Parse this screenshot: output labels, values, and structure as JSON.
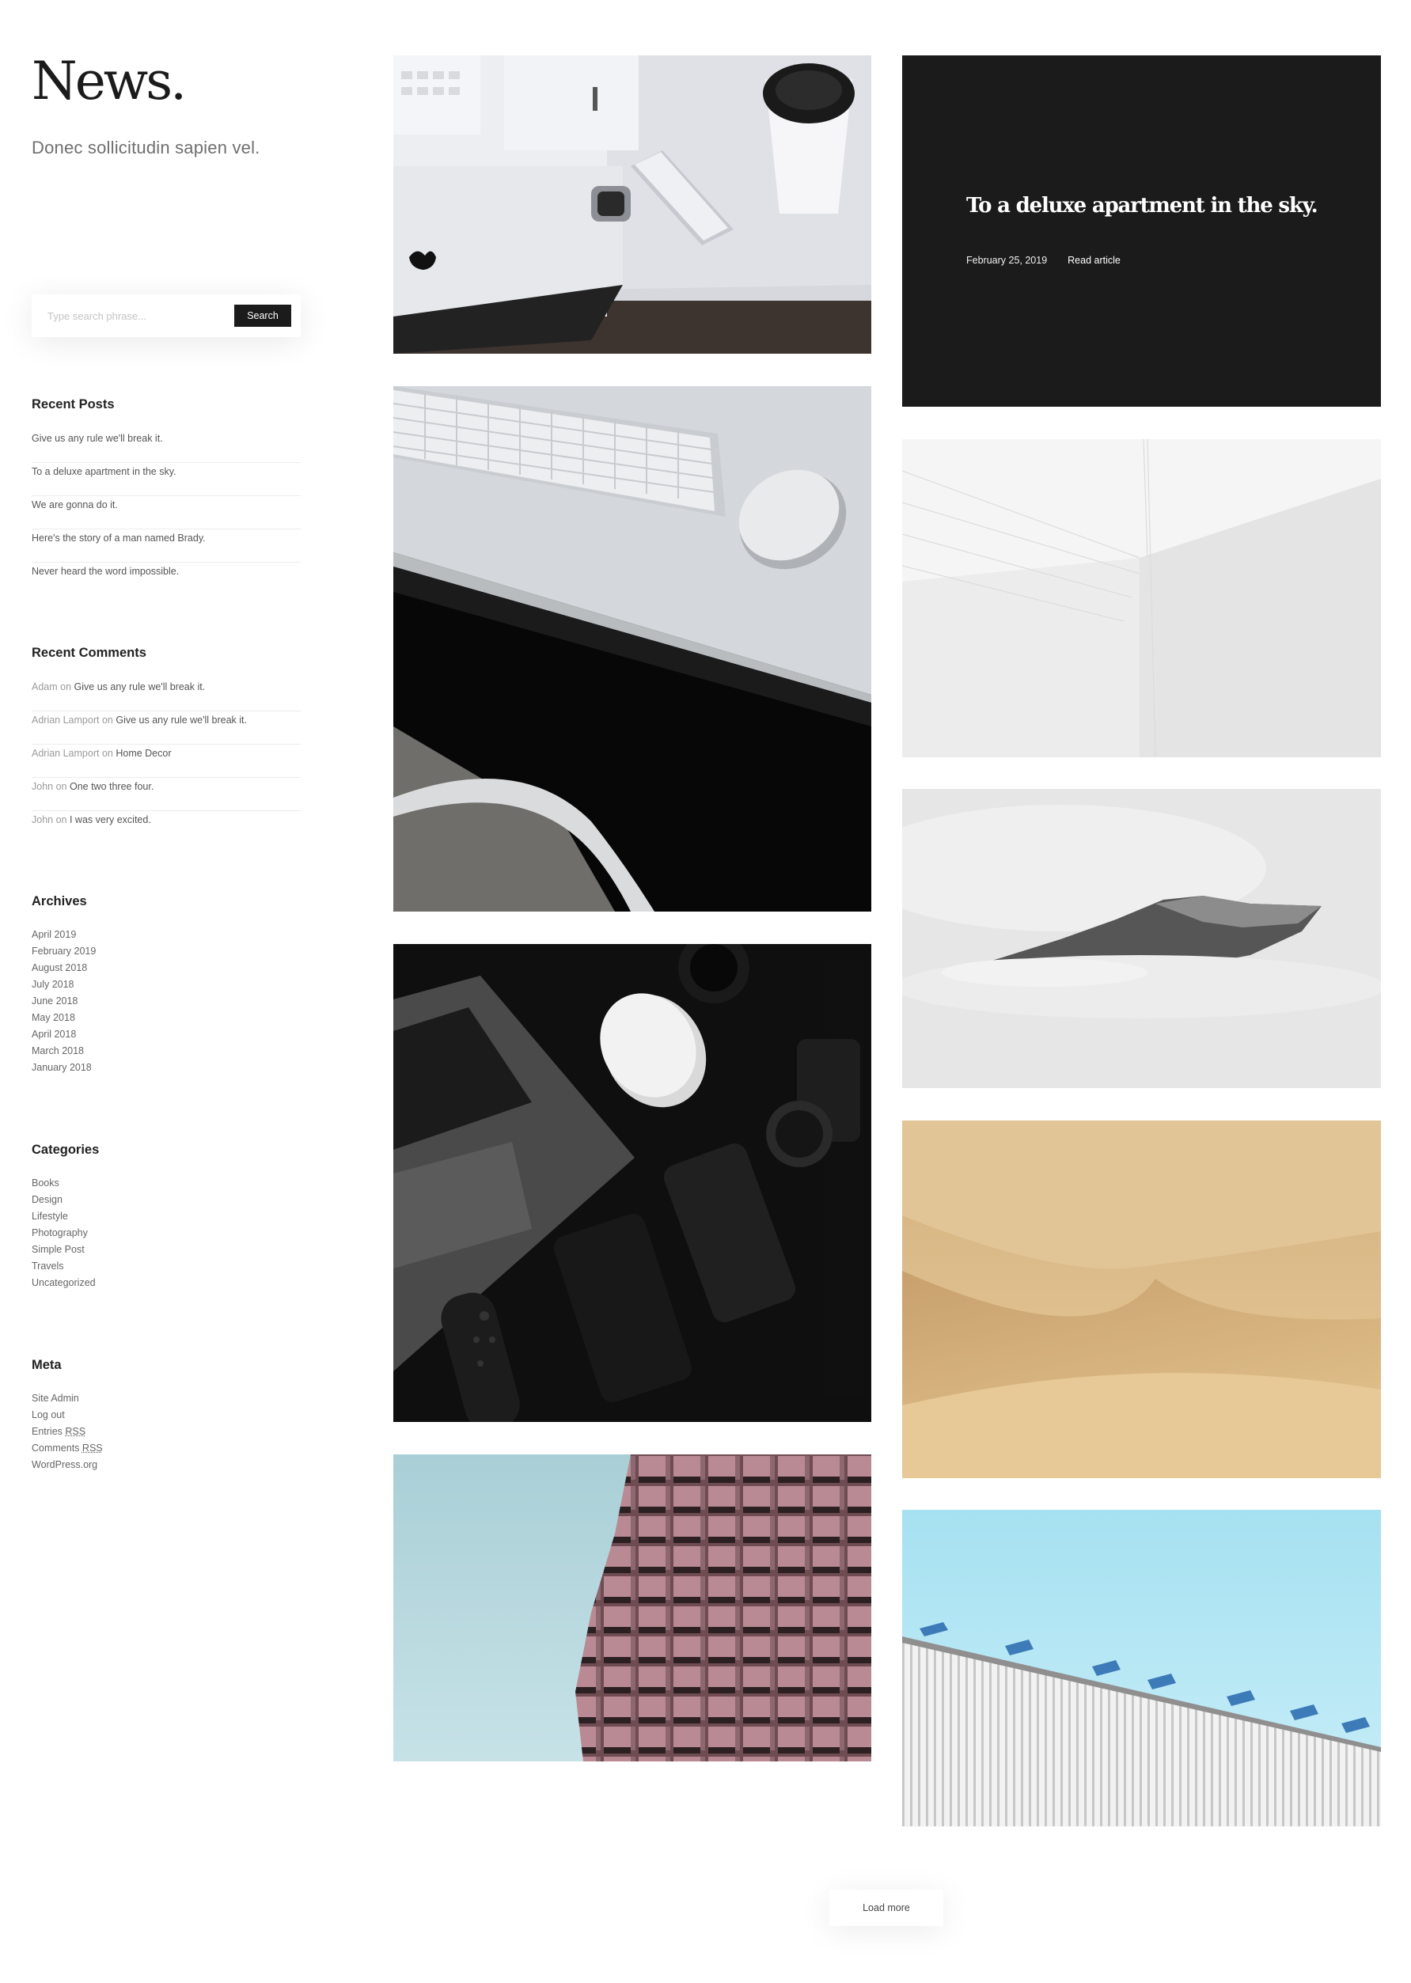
{
  "site": {
    "title": "News.",
    "tagline": "Donec sollicitudin sapien vel."
  },
  "search": {
    "placeholder": "Type search phrase...",
    "button_label": "Search"
  },
  "recent_posts": {
    "title": "Recent Posts",
    "items": [
      "Give us any rule we'll break it.",
      "To a deluxe apartment in the sky.",
      "We are gonna do it.",
      "Here's the story of a man named Brady.",
      "Never heard the word impossible."
    ]
  },
  "recent_comments": {
    "title": "Recent Comments",
    "on_word": "on",
    "items": [
      {
        "author": "Adam",
        "post": "Give us any rule we'll break it."
      },
      {
        "author": "Adrian Lamport",
        "post": "Give us any rule we'll break it."
      },
      {
        "author": "Adrian Lamport",
        "post": "Home Decor"
      },
      {
        "author": "John",
        "post": "One two three four."
      },
      {
        "author": "John",
        "post": "I was very excited."
      }
    ]
  },
  "archives": {
    "title": "Archives",
    "items": [
      "April 2019",
      "February 2019",
      "August 2018",
      "July 2018",
      "June 2018",
      "May 2018",
      "April 2018",
      "March 2018",
      "January 2018"
    ]
  },
  "categories": {
    "title": "Categories",
    "items": [
      "Books",
      "Design",
      "Lifestyle",
      "Photography",
      "Simple Post",
      "Travels",
      "Uncategorized"
    ]
  },
  "meta": {
    "title": "Meta",
    "site_admin": "Site Admin",
    "log_out": "Log out",
    "entries_prefix": "Entries",
    "comments_prefix": "Comments",
    "rss": "RSS",
    "wordpress": "WordPress.org"
  },
  "featured_post": {
    "title": "To a deluxe apartment in the sky.",
    "date": "February 25, 2019",
    "read_label": "Read article"
  },
  "load_more_label": "Load more",
  "colors": {
    "dark": "#1b1b1b",
    "text_muted": "#6f6f6f"
  }
}
